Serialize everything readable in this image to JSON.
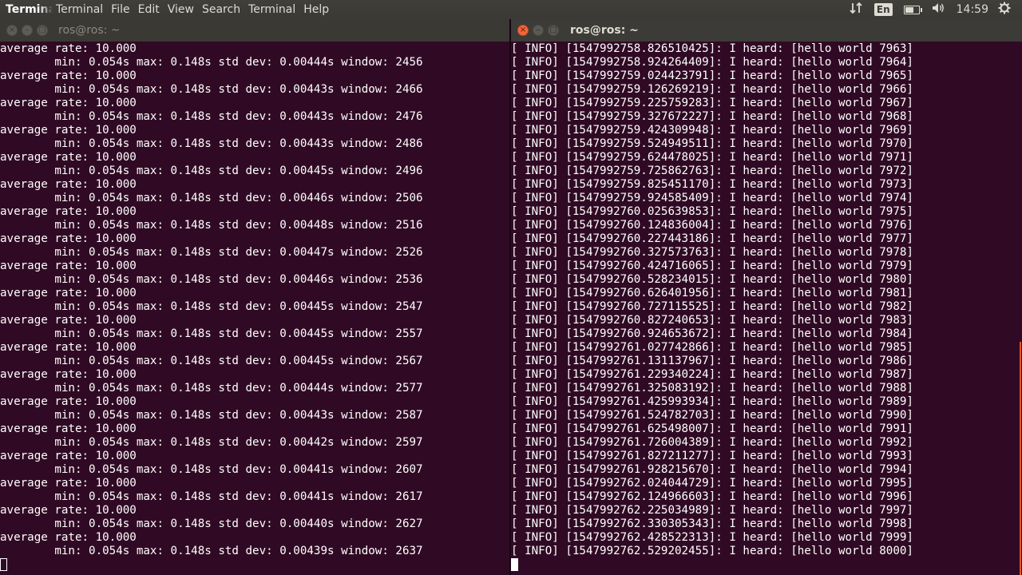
{
  "topbar": {
    "app_name": "Terminal",
    "menu": [
      "Terminal",
      "File",
      "Edit",
      "View",
      "Search",
      "Terminal",
      "Help"
    ],
    "keyboard_layout": "En",
    "battery_level": 0.6,
    "clock": "14:59"
  },
  "left_window": {
    "title": "ros@ros: ~",
    "lines": [
      "average rate: 10.000",
      "        min: 0.054s max: 0.148s std dev: 0.00444s window: 2456",
      "average rate: 10.000",
      "        min: 0.054s max: 0.148s std dev: 0.00443s window: 2466",
      "average rate: 10.000",
      "        min: 0.054s max: 0.148s std dev: 0.00443s window: 2476",
      "average rate: 10.000",
      "        min: 0.054s max: 0.148s std dev: 0.00443s window: 2486",
      "average rate: 10.000",
      "        min: 0.054s max: 0.148s std dev: 0.00445s window: 2496",
      "average rate: 10.000",
      "        min: 0.054s max: 0.148s std dev: 0.00446s window: 2506",
      "average rate: 10.000",
      "        min: 0.054s max: 0.148s std dev: 0.00448s window: 2516",
      "average rate: 10.000",
      "        min: 0.054s max: 0.148s std dev: 0.00447s window: 2526",
      "average rate: 10.000",
      "        min: 0.054s max: 0.148s std dev: 0.00446s window: 2536",
      "average rate: 10.000",
      "        min: 0.054s max: 0.148s std dev: 0.00445s window: 2547",
      "average rate: 10.000",
      "        min: 0.054s max: 0.148s std dev: 0.00445s window: 2557",
      "average rate: 10.000",
      "        min: 0.054s max: 0.148s std dev: 0.00445s window: 2567",
      "average rate: 10.000",
      "        min: 0.054s max: 0.148s std dev: 0.00444s window: 2577",
      "average rate: 10.000",
      "        min: 0.054s max: 0.148s std dev: 0.00443s window: 2587",
      "average rate: 10.000",
      "        min: 0.054s max: 0.148s std dev: 0.00442s window: 2597",
      "average rate: 10.000",
      "        min: 0.054s max: 0.148s std dev: 0.00441s window: 2607",
      "average rate: 10.000",
      "        min: 0.054s max: 0.148s std dev: 0.00441s window: 2617",
      "average rate: 10.000",
      "        min: 0.054s max: 0.148s std dev: 0.00440s window: 2627",
      "average rate: 10.000",
      "        min: 0.054s max: 0.148s std dev: 0.00439s window: 2637"
    ]
  },
  "right_window": {
    "title": "ros@ros: ~",
    "lines": [
      "[ INFO] [1547992758.826510425]: I heard: [hello world 7963]",
      "[ INFO] [1547992758.924264409]: I heard: [hello world 7964]",
      "[ INFO] [1547992759.024423791]: I heard: [hello world 7965]",
      "[ INFO] [1547992759.126269219]: I heard: [hello world 7966]",
      "[ INFO] [1547992759.225759283]: I heard: [hello world 7967]",
      "[ INFO] [1547992759.327672227]: I heard: [hello world 7968]",
      "[ INFO] [1547992759.424309948]: I heard: [hello world 7969]",
      "[ INFO] [1547992759.524949511]: I heard: [hello world 7970]",
      "[ INFO] [1547992759.624478025]: I heard: [hello world 7971]",
      "[ INFO] [1547992759.725862763]: I heard: [hello world 7972]",
      "[ INFO] [1547992759.825451170]: I heard: [hello world 7973]",
      "[ INFO] [1547992759.924585409]: I heard: [hello world 7974]",
      "[ INFO] [1547992760.025639853]: I heard: [hello world 7975]",
      "[ INFO] [1547992760.124836004]: I heard: [hello world 7976]",
      "[ INFO] [1547992760.227443186]: I heard: [hello world 7977]",
      "[ INFO] [1547992760.327573763]: I heard: [hello world 7978]",
      "[ INFO] [1547992760.424716065]: I heard: [hello world 7979]",
      "[ INFO] [1547992760.528234015]: I heard: [hello world 7980]",
      "[ INFO] [1547992760.626401956]: I heard: [hello world 7981]",
      "[ INFO] [1547992760.727115525]: I heard: [hello world 7982]",
      "[ INFO] [1547992760.827240653]: I heard: [hello world 7983]",
      "[ INFO] [1547992760.924653672]: I heard: [hello world 7984]",
      "[ INFO] [1547992761.027742866]: I heard: [hello world 7985]",
      "[ INFO] [1547992761.131137967]: I heard: [hello world 7986]",
      "[ INFO] [1547992761.229340224]: I heard: [hello world 7987]",
      "[ INFO] [1547992761.325083192]: I heard: [hello world 7988]",
      "[ INFO] [1547992761.425993934]: I heard: [hello world 7989]",
      "[ INFO] [1547992761.524782703]: I heard: [hello world 7990]",
      "[ INFO] [1547992761.625498007]: I heard: [hello world 7991]",
      "[ INFO] [1547992761.726004389]: I heard: [hello world 7992]",
      "[ INFO] [1547992761.827211277]: I heard: [hello world 7993]",
      "[ INFO] [1547992761.928215670]: I heard: [hello world 7994]",
      "[ INFO] [1547992762.024044729]: I heard: [hello world 7995]",
      "[ INFO] [1547992762.124966603]: I heard: [hello world 7996]",
      "[ INFO] [1547992762.225034989]: I heard: [hello world 7997]",
      "[ INFO] [1547992762.330305343]: I heard: [hello world 7998]",
      "[ INFO] [1547992762.428522313]: I heard: [hello world 7999]",
      "[ INFO] [1547992762.529202455]: I heard: [hello world 8000]"
    ]
  },
  "colors": {
    "terminal_background": "#300a24",
    "terminal_text": "#ffffff",
    "panel_background": "#3c3b37",
    "close_button_active": "#f0673b",
    "scrollbar_accent": "#e95420"
  }
}
